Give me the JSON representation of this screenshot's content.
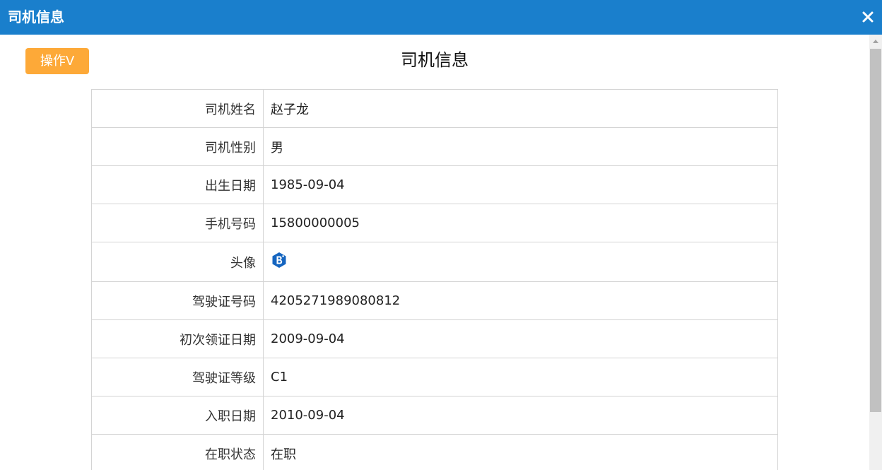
{
  "window": {
    "title": "司机信息"
  },
  "toolbar": {
    "op_label": "操作V"
  },
  "page": {
    "title": "司机信息"
  },
  "colors": {
    "titlebar": "#1a7fcc",
    "op_button": "#fda938",
    "avatar": "#1565c0"
  },
  "fields": [
    {
      "label": "司机姓名",
      "value": "赵子龙"
    },
    {
      "label": "司机性别",
      "value": "男"
    },
    {
      "label": "出生日期",
      "value": "1985-09-04"
    },
    {
      "label": "手机号码",
      "value": "15800000005"
    },
    {
      "label": "头像",
      "icon": "avatar-logo-icon"
    },
    {
      "label": "驾驶证号码",
      "value": "4205271989080812"
    },
    {
      "label": "初次领证日期",
      "value": "2009-09-04"
    },
    {
      "label": "驾驶证等级",
      "value": "C1"
    },
    {
      "label": "入职日期",
      "value": "2010-09-04"
    },
    {
      "label": "在职状态",
      "value": "在职"
    }
  ]
}
